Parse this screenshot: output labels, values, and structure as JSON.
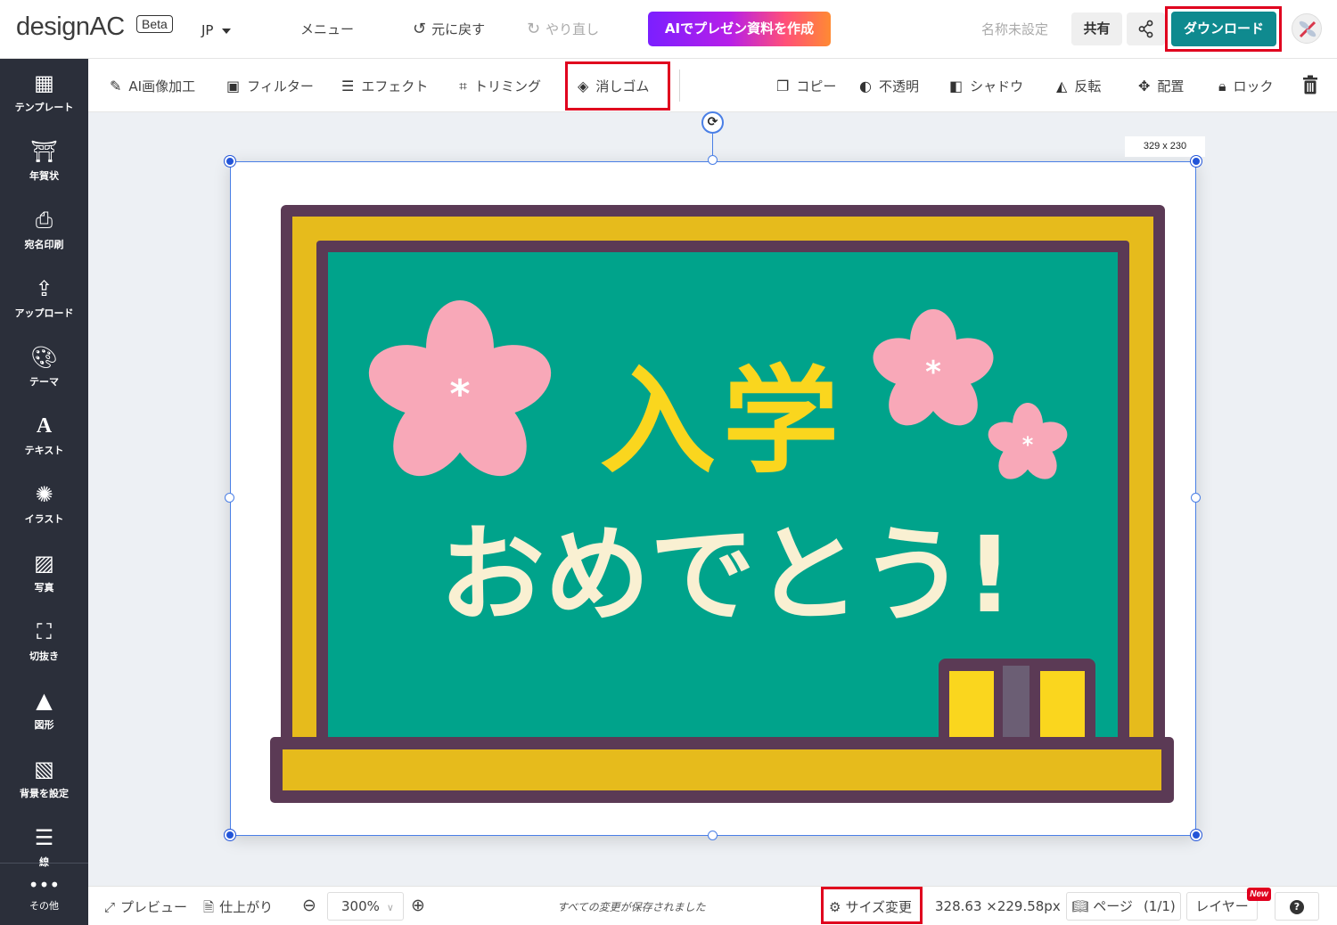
{
  "header": {
    "logo_text": "designAC",
    "beta": "Beta",
    "language": "JP",
    "menu": "メニュー",
    "undo": "元に戻す",
    "redo": "やり直し",
    "ai_button": "AIでプレゼン資料を作成",
    "doc_name": "名称未設定",
    "share": "共有",
    "download": "ダウンロード"
  },
  "toolbar": {
    "ai_edit": "AI画像加工",
    "filter": "フィルター",
    "effect": "エフェクト",
    "trim": "トリミング",
    "eraser": "消しゴム",
    "copy": "コピー",
    "opacity": "不透明",
    "shadow": "シャドウ",
    "flip": "反転",
    "arrange": "配置",
    "lock": "ロック"
  },
  "sidebar": {
    "items": [
      {
        "label": "テンプレート",
        "icon": "template-icon"
      },
      {
        "label": "年賀状",
        "icon": "new-year-card-icon"
      },
      {
        "label": "宛名印刷",
        "icon": "print-icon"
      },
      {
        "label": "アップロード",
        "icon": "upload-icon"
      },
      {
        "label": "テーマ",
        "icon": "palette-icon"
      },
      {
        "label": "テキスト",
        "icon": "text-icon"
      },
      {
        "label": "イラスト",
        "icon": "illustration-icon"
      },
      {
        "label": "写真",
        "icon": "photo-icon"
      },
      {
        "label": "切抜き",
        "icon": "crop-frame-icon"
      },
      {
        "label": "図形",
        "icon": "shapes-icon"
      },
      {
        "label": "背景を設定",
        "icon": "background-icon"
      },
      {
        "label": "線",
        "icon": "lines-icon"
      },
      {
        "label": "その他",
        "icon": "more-icon"
      }
    ]
  },
  "canvas": {
    "size_tag": "329 x 230",
    "illustration": {
      "title": "入学",
      "subtitle": "おめでとう!"
    }
  },
  "bottom": {
    "preview": "プレビュー",
    "finish": "仕上がり",
    "zoom": "300%",
    "saved_status": "すべての変更が保存されました",
    "resize": "サイズ変更",
    "dimensions": "328.63 ×229.58px",
    "page": "ページ",
    "page_count": "(1/1)",
    "layer": "レイヤー",
    "new_badge": "New",
    "help": "?"
  },
  "colors": {
    "sidebar_bg": "#2b2f3a",
    "download": "#0f8a8f",
    "highlight": "#e0001e",
    "board_green": "#00a38b",
    "frame_yellow": "#e6bb1c",
    "frame_purple": "#5b3a55",
    "sakura": "#f8a8b8",
    "title_yellow": "#fad61e",
    "subtitle_cream": "#f9f0d2"
  }
}
